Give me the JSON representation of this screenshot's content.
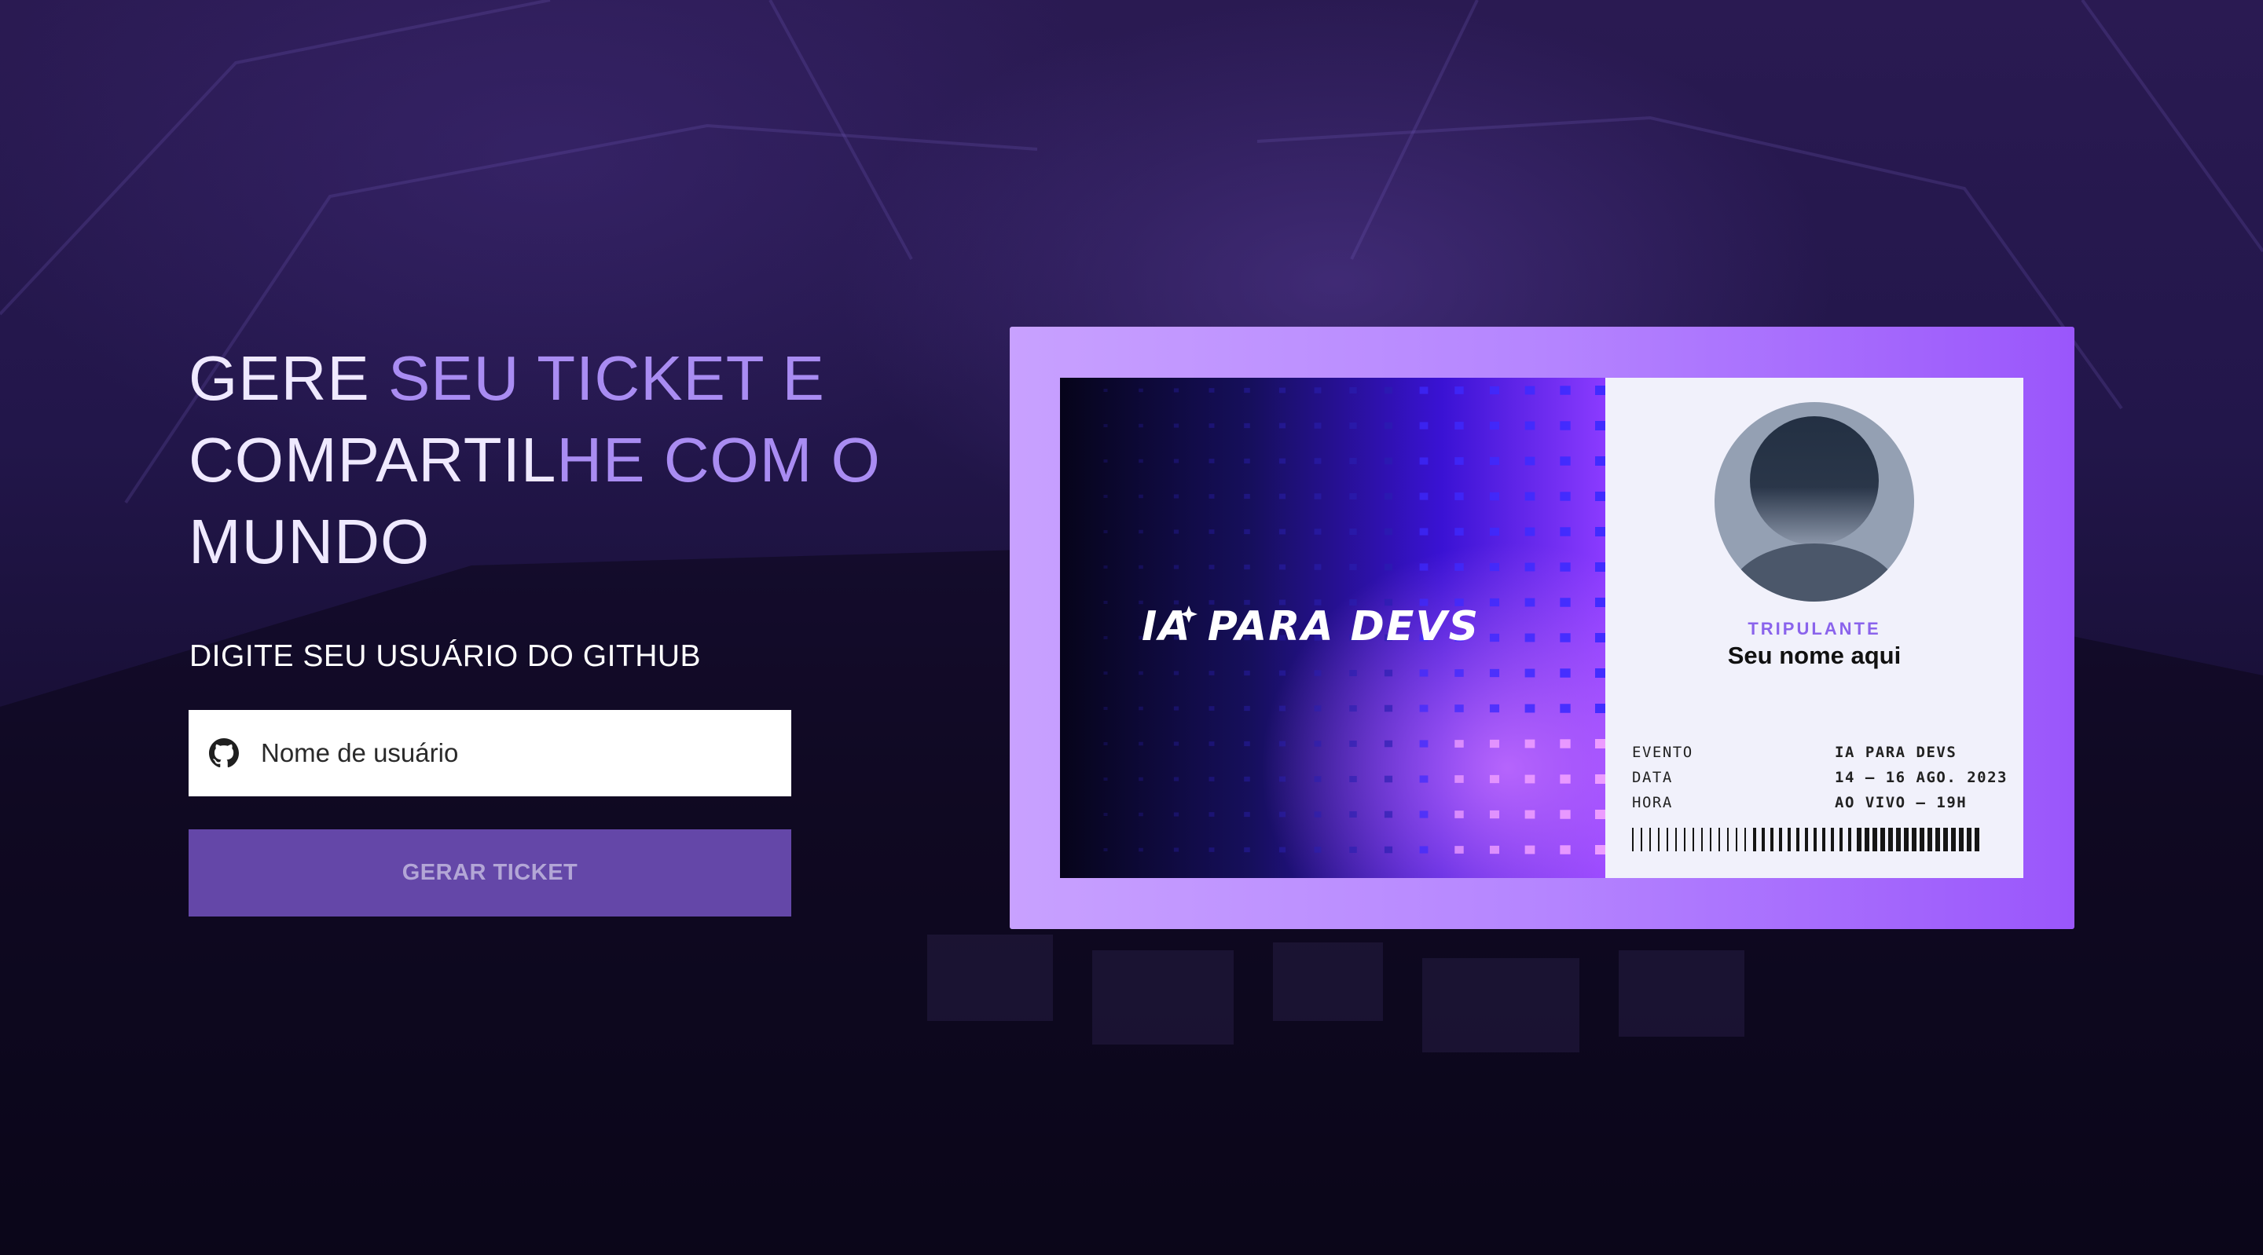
{
  "headline": {
    "line1_white": "GERE",
    "line1_purple": " SEU TICKET E",
    "line2_white": "COMPARTIL",
    "line2_purple": "HE COM O",
    "line3_white": "MUNDO"
  },
  "form": {
    "label": "DIGITE SEU USUÁRIO DO GITHUB",
    "input_placeholder": "Nome de usuário",
    "input_icon": "github-icon",
    "button_label": "GERAR TICKET"
  },
  "ticket": {
    "logo_text": "IA PARA DEVS",
    "role_label": "TRIPULANTE",
    "name_placeholder": "Seu nome aqui",
    "details": [
      {
        "key": "EVENTO",
        "value": "IA PARA DEVS"
      },
      {
        "key": "DATA",
        "value": "14 — 16 AGO. 2023"
      },
      {
        "key": "HORA",
        "value": "AO VIVO — 19H"
      }
    ]
  },
  "colors": {
    "accent": "#6447a8",
    "headline_purple": "#a98cf2",
    "frame_start": "#c8a1ff",
    "frame_end": "#9a56fb",
    "role_label": "#8a63ec"
  }
}
